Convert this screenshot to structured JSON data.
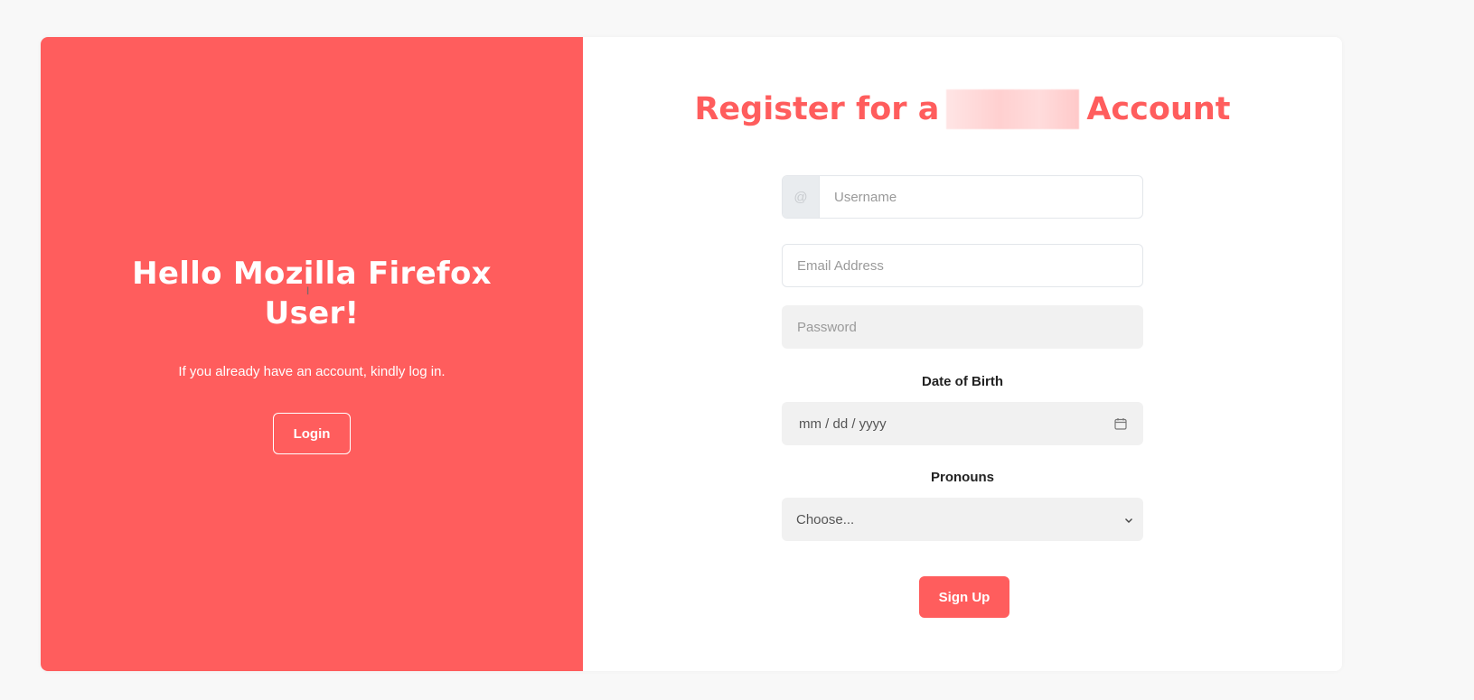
{
  "left_panel": {
    "title": "Hello Mozilla Firefox User!",
    "subtitle": "If you already have an account, kindly log in.",
    "login_label": "Login"
  },
  "form": {
    "title_prefix": "Register for a",
    "title_suffix": "Account",
    "username_addon": "@",
    "username_placeholder": "Username",
    "email_placeholder": "Email Address",
    "password_placeholder": "Password",
    "dob_label": "Date of Birth",
    "dob_placeholder": "mm / dd / yyyy",
    "pronouns_label": "Pronouns",
    "pronouns_selected": "Choose...",
    "signup_label": "Sign Up"
  },
  "colors": {
    "accent": "#ff5d5d",
    "page_background": "#f8f8f8",
    "field_background": "#f1f1f1"
  },
  "icons": {
    "date_picker": "calendar-icon",
    "select": "chevron-down-icon",
    "username_prefix": "at-sign"
  }
}
